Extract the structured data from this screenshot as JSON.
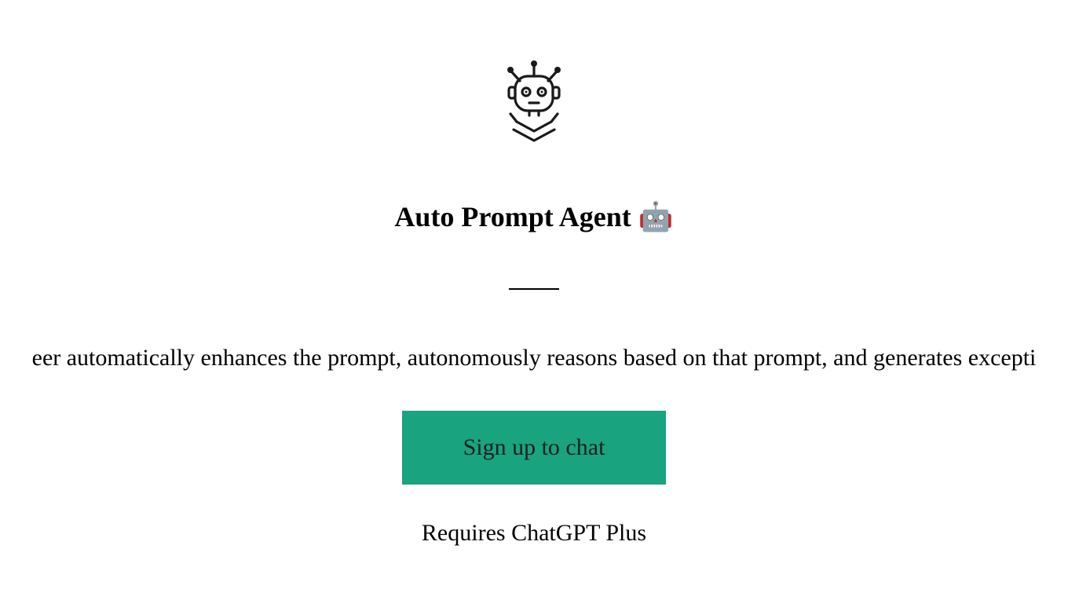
{
  "header": {
    "title": "Auto Prompt Agent 🤖"
  },
  "main": {
    "description": "eer automatically enhances the prompt, autonomously reasons based on that prompt, and generates excepti",
    "signup_label": "Sign up to chat",
    "requires_text": "Requires ChatGPT Plus"
  },
  "colors": {
    "accent": "#19a37f"
  }
}
